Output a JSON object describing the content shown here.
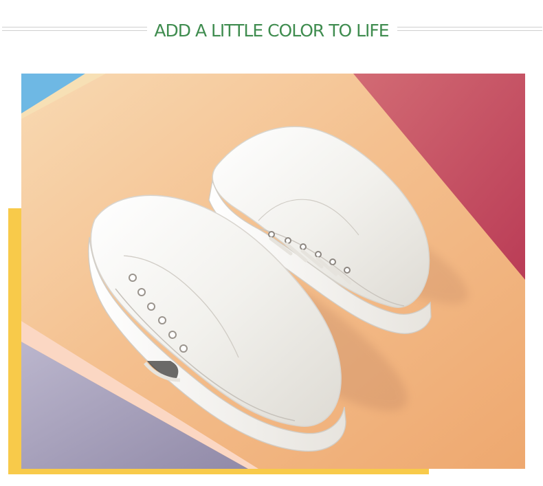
{
  "header": {
    "title": "ADD A LITTLE COLOR TO LIFE",
    "subcopy": "",
    "title_color": "#3f8c4f",
    "rule_color": "#cfcfcf"
  },
  "photo": {
    "subject": "white-sneakers",
    "accent_colors": {
      "yellow": "#f8ca4a",
      "peach": "#f3bc8d",
      "pink": "#c95468",
      "lavender": "#a49db8",
      "blue": "#6eb8e4",
      "sneaker": "#f7f6f2"
    }
  }
}
